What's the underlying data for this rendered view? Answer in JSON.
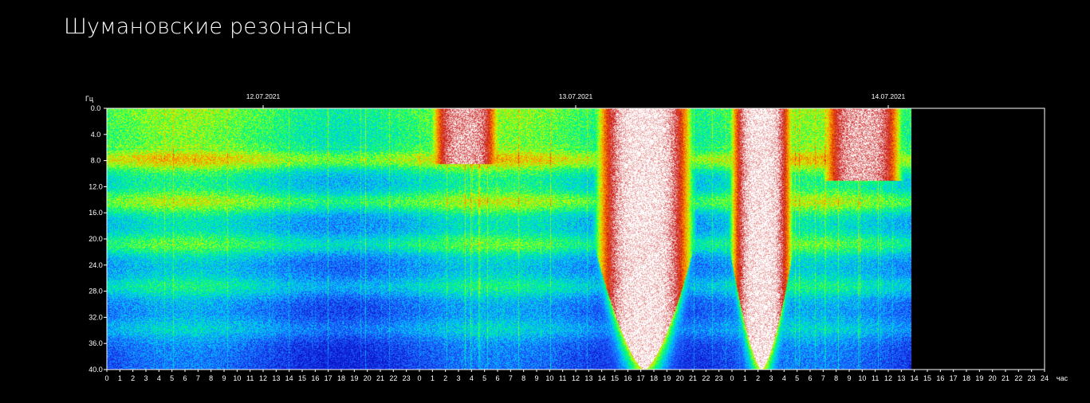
{
  "page": {
    "title": "Шумановские резонансы"
  },
  "colors": {
    "background": "#000000",
    "frame": "#ffffff",
    "text": "#ffffff"
  },
  "chart_data": {
    "type": "heatmap",
    "title": "",
    "ylabel": "Гц",
    "xlabel": "час",
    "ylim": [
      0.0,
      40.0
    ],
    "y_ticks": [
      "0.0",
      "4.0",
      "8.0",
      "12.0",
      "16.0",
      "20.0",
      "24.0",
      "28.0",
      "32.0",
      "36.0",
      "40.0"
    ],
    "x_ticks": [
      "0",
      "1",
      "2",
      "3",
      "4",
      "5",
      "6",
      "7",
      "8",
      "9",
      "10",
      "11",
      "12",
      "13",
      "14",
      "15",
      "16",
      "17",
      "18",
      "19",
      "20",
      "21",
      "22",
      "23",
      "0",
      "1",
      "2",
      "3",
      "4",
      "5",
      "6",
      "7",
      "8",
      "9",
      "10",
      "11",
      "12",
      "13",
      "14",
      "15",
      "16",
      "17",
      "18",
      "19",
      "20",
      "21",
      "22",
      "23",
      "0",
      "1",
      "2",
      "3",
      "4",
      "5",
      "6",
      "7",
      "8",
      "9",
      "10",
      "11",
      "12",
      "13",
      "14",
      "15",
      "16",
      "17",
      "18",
      "19",
      "20",
      "21",
      "22",
      "23",
      "24"
    ],
    "dates": [
      {
        "label": "12.07.2021",
        "hour": 12
      },
      {
        "label": "13.07.2021",
        "hour": 36
      },
      {
        "label": "14.07.2021",
        "hour": 60
      }
    ],
    "x_range_hours": [
      0,
      72
    ],
    "data_end_hour": 61.8,
    "colorscale": [
      "#0a14c8",
      "#1e5aff",
      "#00c8ff",
      "#00ff6e",
      "#c8ff00",
      "#ff8c00",
      "#c81414",
      "#ffffff"
    ],
    "bursts": [
      {
        "start_hour": 24.5,
        "end_hour": 30.5,
        "note": "white activity 0–8 Hz"
      },
      {
        "start_hour": 37.0,
        "end_hour": 45.5,
        "note": "white activity full band"
      },
      {
        "start_hour": 47.5,
        "end_hour": 53.0,
        "note": "white activity full band"
      },
      {
        "start_hour": 54.5,
        "end_hour": 61.5,
        "note": "white/red activity 0–10 Hz"
      }
    ]
  }
}
